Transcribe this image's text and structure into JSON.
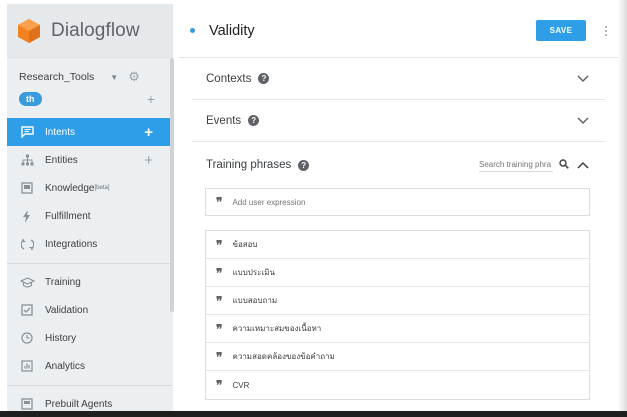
{
  "app": {
    "name": "Dialogflow",
    "brand_color": "#f4811f",
    "accent_color": "#2e9ee8"
  },
  "sidebar": {
    "agent_name": "Research_Tools",
    "language_badge": "th",
    "items": [
      {
        "label": "Intents",
        "icon": "intents-icon",
        "active": true,
        "has_add": true
      },
      {
        "label": "Entities",
        "icon": "entities-icon",
        "active": false,
        "has_add": true
      },
      {
        "label": "Knowledge",
        "badge": "[beta]",
        "icon": "knowledge-icon",
        "active": false
      },
      {
        "label": "Fulfillment",
        "icon": "fulfillment-icon",
        "active": false
      },
      {
        "label": "Integrations",
        "icon": "integrations-icon",
        "active": false
      },
      {
        "label": "Training",
        "icon": "training-icon",
        "active": false
      },
      {
        "label": "Validation",
        "icon": "validation-icon",
        "active": false
      },
      {
        "label": "History",
        "icon": "history-icon",
        "active": false
      },
      {
        "label": "Analytics",
        "icon": "analytics-icon",
        "active": false
      },
      {
        "label": "Prebuilt Agents",
        "icon": "prebuilt-agents-icon",
        "active": false
      }
    ]
  },
  "main": {
    "intent_title": "Validity",
    "save_label": "SAVE",
    "sections": {
      "contexts": "Contexts",
      "events": "Events",
      "training_phrases": "Training phrases"
    },
    "search_placeholder": "Search training phra",
    "add_placeholder": "Add user expression",
    "phrases": [
      "ข้อสอบ",
      "แบบประเมิน",
      "แบบสอบถาม",
      "ความเหมาะสมของเนื้อหา",
      "ความสอดคล้องของข้อคำถาม",
      "CVR"
    ]
  }
}
